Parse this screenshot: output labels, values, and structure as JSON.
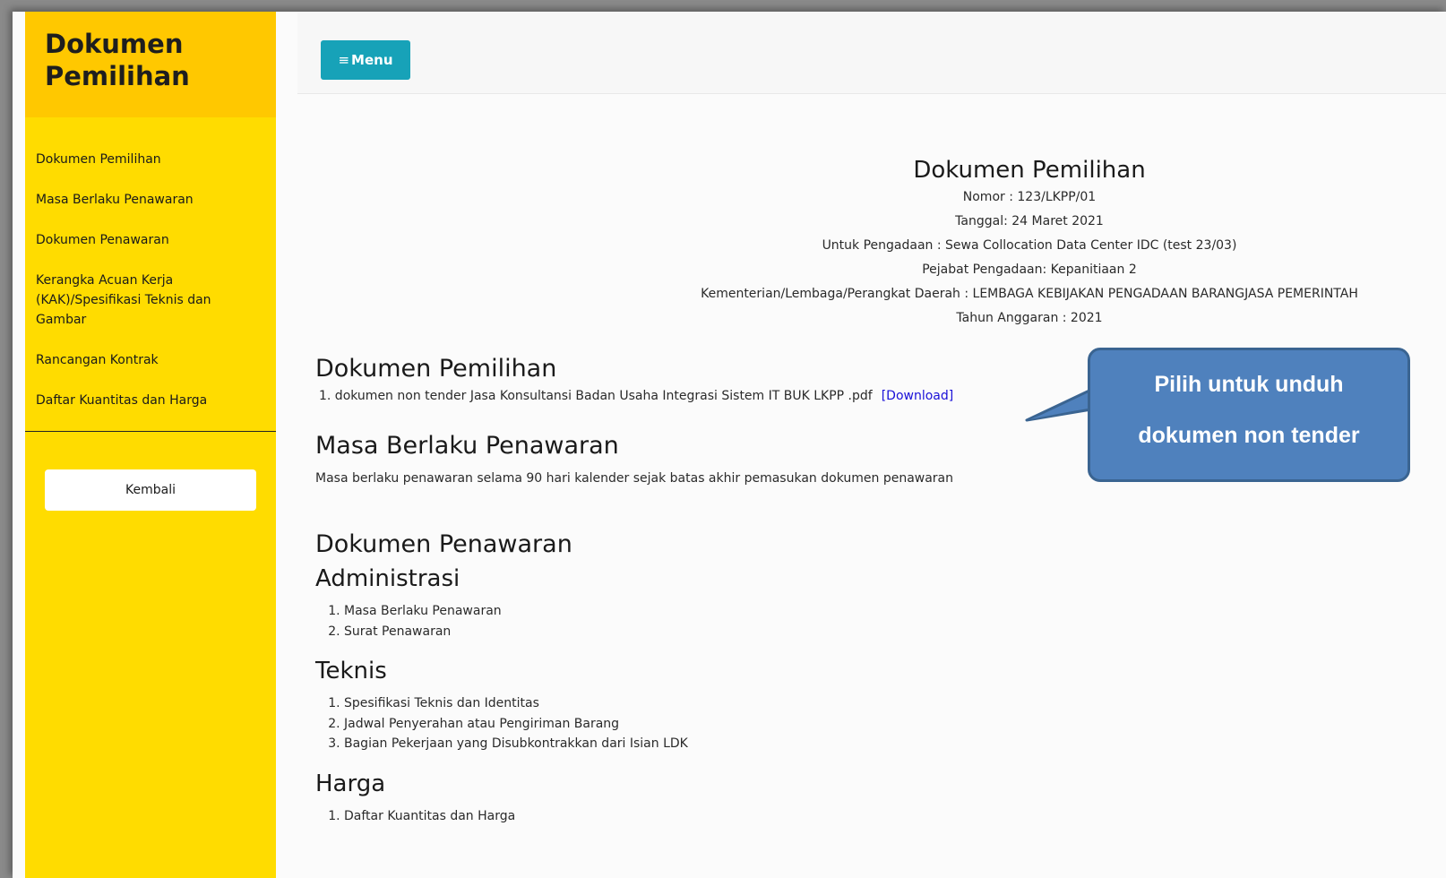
{
  "sidebar": {
    "title_line1": "Dokumen",
    "title_line2": "Pemilihan",
    "items": [
      "Dokumen Pemilihan",
      "Masa Berlaku Penawaran",
      "Dokumen Penawaran",
      "Kerangka Acuan Kerja (KAK)/Spesifikasi Teknis dan Gambar",
      "Rancangan Kontrak",
      "Daftar Kuantitas dan Harga"
    ],
    "back_label": "Kembali"
  },
  "topbar": {
    "menu_label": "Menu"
  },
  "header": {
    "title": "Dokumen Pemilihan",
    "nomor": "Nomor : 123/LKPP/01",
    "tanggal": "Tanggal: 24 Maret 2021",
    "pengadaan": "Untuk Pengadaan : Sewa Collocation Data Center IDC (test 23/03)",
    "pejabat": "Pejabat Pengadaan: Kepanitiaan 2",
    "kementerian": "Kementerian/Lembaga/Perangkat Daerah : LEMBAGA KEBIJAKAN PENGADAAN BARANGJASA PEMERINTAH",
    "tahun": "Tahun Anggaran : 2021"
  },
  "sections": {
    "dokumen_pemilihan": {
      "heading": "Dokumen Pemilihan",
      "file": "1. dokumen non tender Jasa Konsultansi Badan Usaha Integrasi Sistem IT BUK LKPP .pdf",
      "download_label": "[Download]"
    },
    "masa_berlaku": {
      "heading": "Masa Berlaku Penawaran",
      "text": "Masa berlaku penawaran selama 90 hari kalender sejak batas akhir pemasukan dokumen penawaran"
    },
    "dokumen_penawaran": {
      "heading": "Dokumen Penawaran",
      "administrasi": {
        "heading": "Administrasi",
        "items": [
          "Masa Berlaku Penawaran",
          "Surat Penawaran"
        ]
      },
      "teknis": {
        "heading": "Teknis",
        "items": [
          "Spesifikasi Teknis dan Identitas",
          "Jadwal Penyerahan atau Pengiriman Barang",
          "Bagian Pekerjaan yang Disubkontrakkan dari Isian LDK"
        ]
      },
      "harga": {
        "heading": "Harga",
        "items": [
          "Daftar Kuantitas dan Harga"
        ]
      }
    }
  },
  "callout": {
    "line1": "Pilih untuk unduh",
    "line2": "dokumen non tender"
  }
}
